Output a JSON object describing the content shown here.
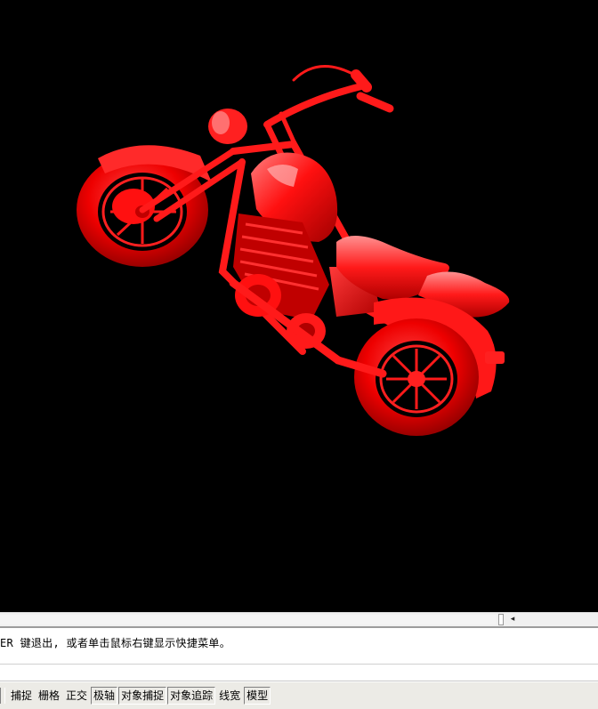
{
  "viewport": {
    "background_color": "#000000",
    "model_color": "#ff0000",
    "model_subject": "motorcycle-3d-model"
  },
  "command": {
    "line_text": "ER 键退出, 或者单击鼠标右键显示快捷菜单。",
    "input_text": ""
  },
  "status_bar": {
    "buttons": [
      {
        "label": "捕捉"
      },
      {
        "label": "栅格"
      },
      {
        "label": "正交"
      },
      {
        "label": "极轴"
      },
      {
        "label": "对象捕捉"
      },
      {
        "label": "对象追踪"
      },
      {
        "label": "线宽"
      },
      {
        "label": "模型"
      }
    ]
  }
}
